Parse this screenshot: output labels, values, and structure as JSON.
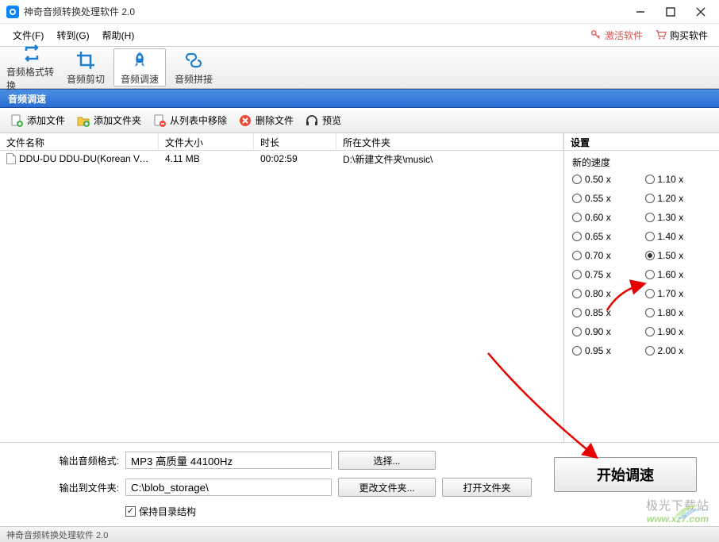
{
  "window": {
    "title": "神奇音频转换处理软件 2.0"
  },
  "menu": {
    "file": "文件(F)",
    "goto": "转到(G)",
    "help": "帮助(H)",
    "activate": "激活软件",
    "buy": "购买软件"
  },
  "toolbar": {
    "format_convert": "音频格式转换",
    "trim": "音频剪切",
    "speed": "音频调速",
    "join": "音频拼接"
  },
  "section_title": "音频调速",
  "actions": {
    "add_file": "添加文件",
    "add_folder": "添加文件夹",
    "remove_from_list": "从列表中移除",
    "delete_file": "删除文件",
    "preview": "预览"
  },
  "columns": {
    "name": "文件名称",
    "size": "文件大小",
    "duration": "时长",
    "folder": "所在文件夹"
  },
  "files": [
    {
      "name": "DDU-DU DDU-DU(Korean Ver....",
      "size": "4.11 MB",
      "duration": "00:02:59",
      "folder": "D:\\新建文件夹\\music\\"
    }
  ],
  "settings": {
    "header": "设置",
    "group_title": "新的速度",
    "selected": "1.50 x",
    "options_col1": [
      "0.50 x",
      "0.55 x",
      "0.60 x",
      "0.65 x",
      "0.70 x",
      "0.75 x",
      "0.80 x",
      "0.85 x",
      "0.90 x",
      "0.95 x"
    ],
    "options_col2": [
      "1.10 x",
      "1.20 x",
      "1.30 x",
      "1.40 x",
      "1.50 x",
      "1.60 x",
      "1.70 x",
      "1.80 x",
      "1.90 x",
      "2.00 x"
    ]
  },
  "output": {
    "format_label": "输出音频格式:",
    "format_value": "MP3 高质量 44100Hz",
    "select_btn": "选择...",
    "folder_label": "输出到文件夹:",
    "folder_value": "C:\\blob_storage\\",
    "change_btn": "更改文件夹...",
    "open_btn": "打开文件夹",
    "keep_structure": "保持目录结构"
  },
  "start_button": "开始调速",
  "statusbar": "神奇音频转换处理软件 2.0",
  "watermark": {
    "line1": "极光下载站",
    "line2": "www.xz7.com"
  }
}
